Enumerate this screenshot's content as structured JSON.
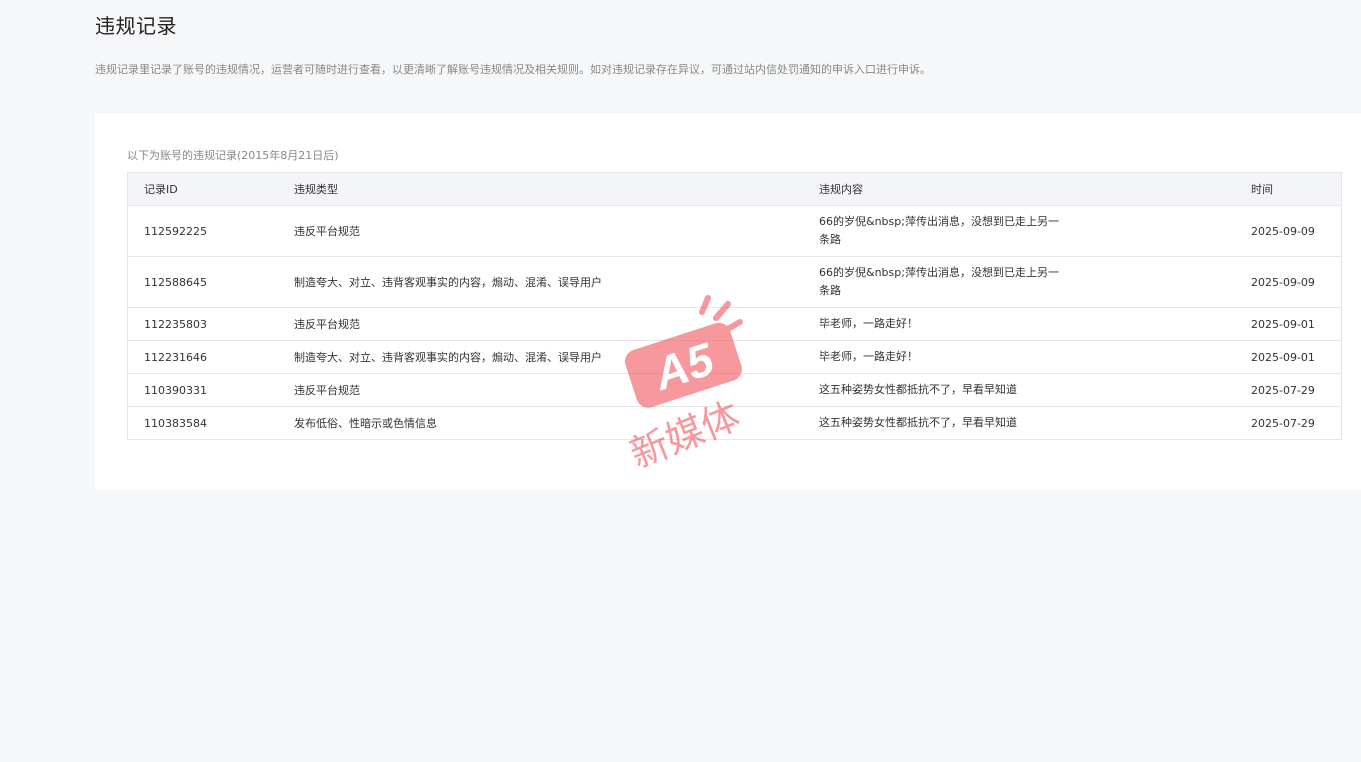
{
  "page": {
    "title": "违规记录",
    "description": "违规记录里记录了账号的违规情况，运营者可随时进行查看，以更清晰了解账号违规情况及相关规则。如对违规记录存在异议，可通过站内信处罚通知的申诉入口进行申诉。"
  },
  "records": {
    "caption": "以下为账号的违规记录(2015年8月21日后)",
    "columns": {
      "id": "记录ID",
      "type": "违规类型",
      "content": "违规内容",
      "time": "时间"
    },
    "rows": [
      {
        "id": "112592225",
        "type": "违反平台规范",
        "content": "66的岁倪&nbsp;萍传出消息，没想到已走上另一条路",
        "time": "2025-09-09"
      },
      {
        "id": "112588645",
        "type": "制造夸大、对立、违背客观事实的内容，煽动、混淆、误导用户",
        "content": "66的岁倪&nbsp;萍传出消息，没想到已走上另一条路",
        "time": "2025-09-09"
      },
      {
        "id": "112235803",
        "type": "违反平台规范",
        "content": "毕老师，一路走好！",
        "time": "2025-09-01"
      },
      {
        "id": "112231646",
        "type": "制造夸大、对立、违背客观事实的内容，煽动、混淆、误导用户",
        "content": "毕老师，一路走好！",
        "time": "2025-09-01"
      },
      {
        "id": "110390331",
        "type": "违反平台规范",
        "content": "这五种姿势女性都抵抗不了，早看早知道",
        "time": "2025-07-29"
      },
      {
        "id": "110383584",
        "type": "发布低俗、性暗示或色情信息",
        "content": "这五种姿势女性都抵抗不了，早看早知道",
        "time": "2025-07-29"
      }
    ]
  },
  "watermark": {
    "logo_text": "A5",
    "text": "新媒体",
    "color": "#f0454c"
  }
}
